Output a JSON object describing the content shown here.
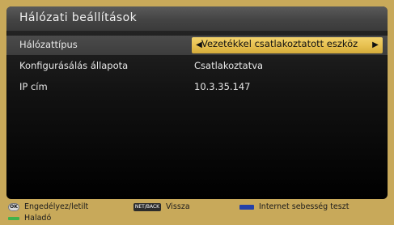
{
  "title": "Hálózati beállítások",
  "rows": [
    {
      "label": "Hálózattípus",
      "value": "Vezetékkel csatlakoztatott eszköz"
    },
    {
      "label": "Konfigurásálás állapota",
      "value": "Csatlakoztatva"
    },
    {
      "label": "IP cím",
      "value": "10.3.35.147"
    }
  ],
  "footer": {
    "ok_key": "OK",
    "ok_text": "Engedélyez/letilt",
    "green_text": "Haladó",
    "netback_key": "NET/BACK",
    "netback_text": "Vissza",
    "blue_text": "Internet sebesség teszt"
  },
  "colors": {
    "panel": "#000000",
    "header": "#4a4a4a",
    "accent_yellow": "#e6bf4f",
    "frame_gold": "#c8a95a",
    "green": "#41b24a",
    "blue": "#2441a8"
  },
  "icons": [
    "left-arrow-icon",
    "right-arrow-icon",
    "ok-button-icon",
    "green-button-icon",
    "netback-button-icon",
    "blue-button-icon"
  ]
}
